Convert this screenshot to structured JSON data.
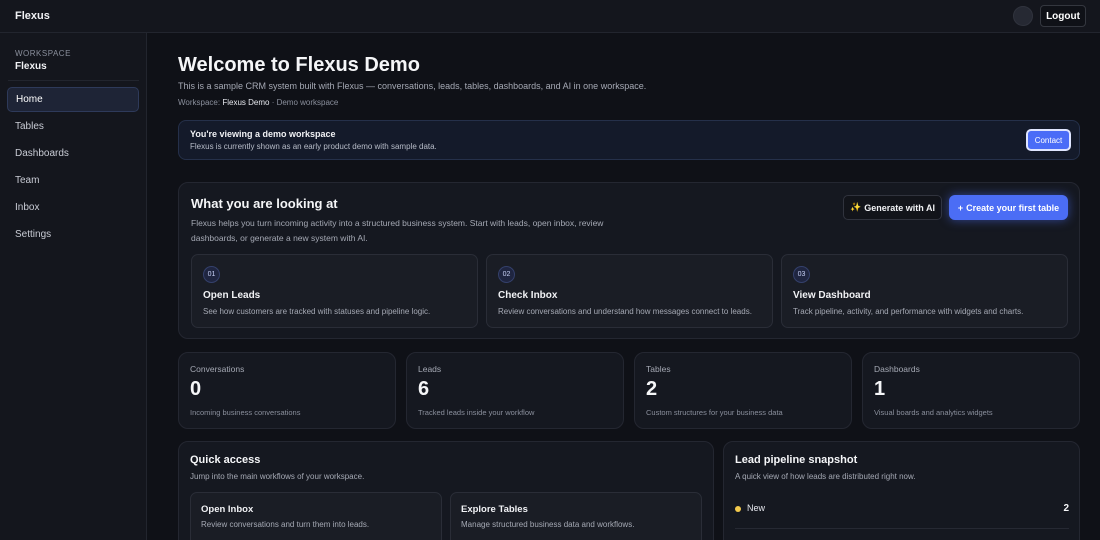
{
  "app": {
    "name": "Flexus"
  },
  "header": {
    "logout_label": "Logout"
  },
  "sidebar": {
    "workspace_label": "WORKSPACE",
    "workspace_name": "Flexus",
    "items": [
      {
        "label": "Home",
        "active": true
      },
      {
        "label": "Tables"
      },
      {
        "label": "Dashboards"
      },
      {
        "label": "Team"
      },
      {
        "label": "Inbox"
      },
      {
        "label": "Settings"
      }
    ]
  },
  "page": {
    "title": "Welcome to Flexus Demo",
    "subtitle": "This is a sample CRM system built with Flexus — conversations, leads, tables, dashboards, and AI in one workspace.",
    "workspace_prefix": "Workspace:",
    "workspace_name": "Flexus Demo",
    "workspace_suffix": "· Demo workspace"
  },
  "banner": {
    "title": "You're viewing a demo workspace",
    "subtitle": "Flexus is currently shown as an early product demo with sample data.",
    "contact_label": "Contact"
  },
  "looking": {
    "title": "What you are looking at",
    "description": "Flexus helps you turn incoming activity into a structured business system. Start with leads, open inbox, review dashboards, or generate a new system with AI.",
    "generate_label": "Generate with AI",
    "create_label": "Create your first table",
    "steps": [
      {
        "num": "01",
        "title": "Open Leads",
        "desc": "See how customers are tracked with statuses and pipeline logic."
      },
      {
        "num": "02",
        "title": "Check Inbox",
        "desc": "Review conversations and understand how messages connect to leads."
      },
      {
        "num": "03",
        "title": "View Dashboard",
        "desc": "Track pipeline, activity, and performance with widgets and charts."
      }
    ]
  },
  "stats": [
    {
      "label": "Conversations",
      "value": "0",
      "desc": "Incoming business conversations"
    },
    {
      "label": "Leads",
      "value": "6",
      "desc": "Tracked leads inside your workflow"
    },
    {
      "label": "Tables",
      "value": "2",
      "desc": "Custom structures for your business data"
    },
    {
      "label": "Dashboards",
      "value": "1",
      "desc": "Visual boards and analytics widgets"
    }
  ],
  "quick_access": {
    "title": "Quick access",
    "subtitle": "Jump into the main workflows of your workspace.",
    "cards": [
      {
        "title": "Open Inbox",
        "desc": "Review conversations and turn them into leads."
      },
      {
        "title": "Explore Tables",
        "desc": "Manage structured business data and workflows."
      }
    ]
  },
  "pipeline": {
    "title": "Lead pipeline snapshot",
    "subtitle": "A quick view of how leads are distributed right now.",
    "rows": [
      {
        "label": "New",
        "count": "2",
        "color": "#f2c94c"
      }
    ]
  },
  "colors": {
    "accent": "#4b6df5",
    "background": "#0f1117",
    "new_status": "#f2c94c"
  }
}
